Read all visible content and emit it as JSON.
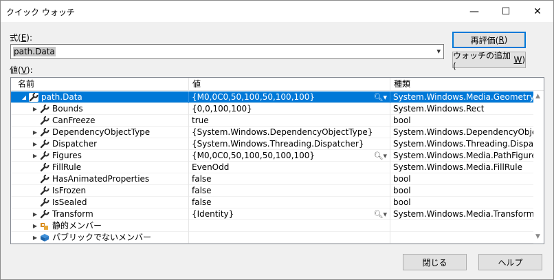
{
  "window": {
    "title": "クイック ウォッチ",
    "minimize_glyph": "—",
    "maximize_glyph": "☐",
    "close_glyph": "✕"
  },
  "expression": {
    "label_pre": "式(",
    "label_key": "E",
    "label_post": "):",
    "value": "path.Data"
  },
  "values_label": {
    "pre": "値(",
    "key": "V",
    "post": "):"
  },
  "buttons": {
    "reevaluate_pre": "再評価(",
    "reevaluate_key": "R",
    "reevaluate_post": ")",
    "add_watch_pre": "ウォッチの追加(",
    "add_watch_key": "W",
    "add_watch_post": ")",
    "close": "閉じる",
    "help": "ヘルプ"
  },
  "columns": {
    "name": "名前",
    "value": "値",
    "type": "種類"
  },
  "rows": [
    {
      "name": "path.Data",
      "value": "{M0,0C0,50,100,50,100,100}",
      "type": "System.Windows.Media.Geometry {...",
      "level": 0,
      "expander": "expanded",
      "icon": "wrench-icon",
      "viz": true
    },
    {
      "name": "Bounds",
      "value": "{0,0,100,100}",
      "type": "System.Windows.Rect",
      "level": 1,
      "expander": "collapsed",
      "icon": "wrench-icon",
      "viz": false
    },
    {
      "name": "CanFreeze",
      "value": "true",
      "type": "bool",
      "level": 1,
      "expander": "none",
      "icon": "wrench-icon",
      "viz": false
    },
    {
      "name": "DependencyObjectType",
      "value": "{System.Windows.DependencyObjectType}",
      "type": "System.Windows.DependencyObjec...",
      "level": 1,
      "expander": "collapsed",
      "icon": "wrench-icon",
      "viz": false
    },
    {
      "name": "Dispatcher",
      "value": "{System.Windows.Threading.Dispatcher}",
      "type": "System.Windows.Threading.Dispatc...",
      "level": 1,
      "expander": "collapsed",
      "icon": "wrench-icon",
      "viz": false
    },
    {
      "name": "Figures",
      "value": "{M0,0C0,50,100,50,100,100}",
      "type": "System.Windows.Media.PathFigure...",
      "level": 1,
      "expander": "collapsed",
      "icon": "wrench-icon",
      "viz": true
    },
    {
      "name": "FillRule",
      "value": "EvenOdd",
      "type": "System.Windows.Media.FillRule",
      "level": 1,
      "expander": "none",
      "icon": "wrench-icon",
      "viz": false
    },
    {
      "name": "HasAnimatedProperties",
      "value": "false",
      "type": "bool",
      "level": 1,
      "expander": "none",
      "icon": "wrench-icon",
      "viz": false
    },
    {
      "name": "IsFrozen",
      "value": "false",
      "type": "bool",
      "level": 1,
      "expander": "none",
      "icon": "wrench-icon",
      "viz": false
    },
    {
      "name": "IsSealed",
      "value": "false",
      "type": "bool",
      "level": 1,
      "expander": "none",
      "icon": "wrench-icon",
      "viz": false
    },
    {
      "name": "Transform",
      "value": "{Identity}",
      "type": "System.Windows.Media.Transform {...",
      "level": 1,
      "expander": "collapsed",
      "icon": "wrench-icon",
      "viz": true
    },
    {
      "name": "静的メンバー",
      "value": "",
      "type": "",
      "level": 1,
      "expander": "collapsed",
      "icon": "static-members-icon",
      "viz": false
    },
    {
      "name": "パブリックでないメンバー",
      "value": "",
      "type": "",
      "level": 1,
      "expander": "collapsed",
      "icon": "non-public-members-icon",
      "viz": false
    }
  ],
  "selected_row": 0,
  "colors": {
    "selection": "#0078d7",
    "default_button_border": "#0078d7"
  }
}
